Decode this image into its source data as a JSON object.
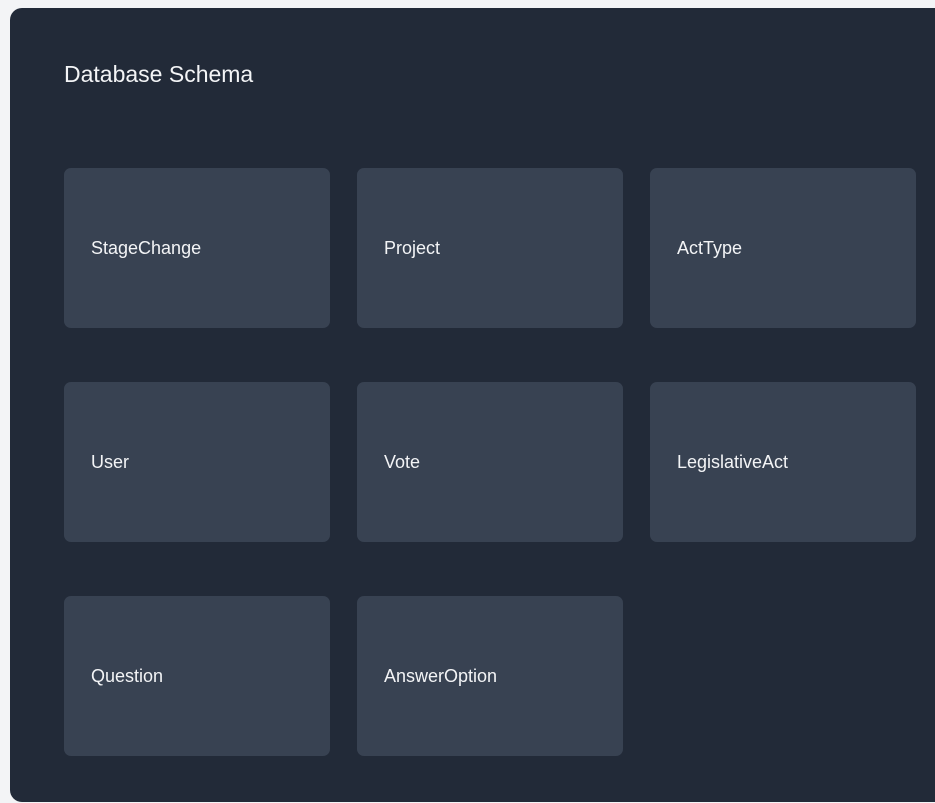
{
  "title": "Database Schema",
  "entities": [
    {
      "name": "StageChange"
    },
    {
      "name": "Project"
    },
    {
      "name": "ActType"
    },
    {
      "name": "User"
    },
    {
      "name": "Vote"
    },
    {
      "name": "LegislativeAct"
    },
    {
      "name": "Question"
    },
    {
      "name": "AnswerOption"
    }
  ],
  "colors": {
    "panel_background": "#222a38",
    "card_background": "#384252",
    "text": "#f3f4f6"
  }
}
